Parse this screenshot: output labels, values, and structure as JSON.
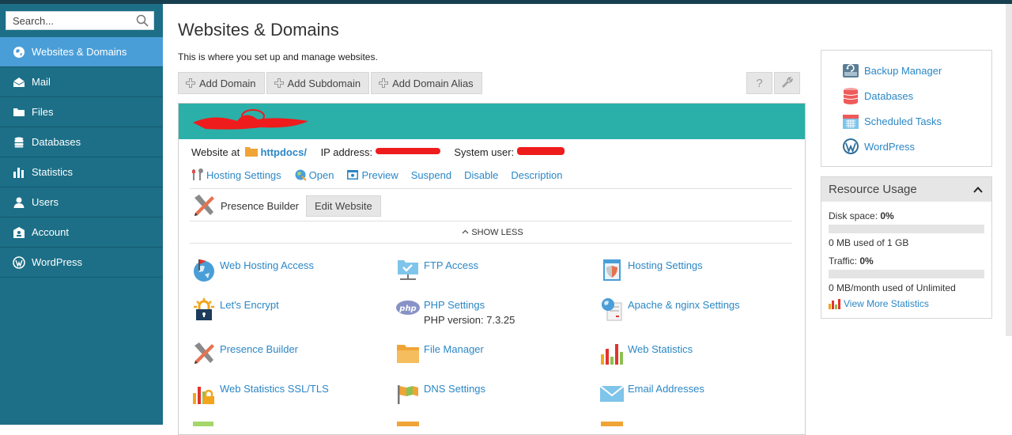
{
  "search": {
    "placeholder": "Search..."
  },
  "sidebar": {
    "items": [
      {
        "label": "Websites & Domains",
        "icon": "globe-icon",
        "active": true
      },
      {
        "label": "Mail",
        "icon": "envelope-icon"
      },
      {
        "label": "Files",
        "icon": "folder-icon"
      },
      {
        "label": "Databases",
        "icon": "database-icon"
      },
      {
        "label": "Statistics",
        "icon": "bar-chart-icon"
      },
      {
        "label": "Users",
        "icon": "user-icon"
      },
      {
        "label": "Account",
        "icon": "account-icon"
      },
      {
        "label": "WordPress",
        "icon": "wordpress-icon"
      }
    ]
  },
  "main": {
    "title": "Websites & Domains",
    "description": "This is where you set up and manage websites.",
    "toolbar": {
      "add_domain": "Add Domain",
      "add_subdomain": "Add Subdomain",
      "add_domain_alias": "Add Domain Alias",
      "help_icon": "?",
      "settings_icon": "wrench-icon"
    }
  },
  "domain": {
    "website_at_label": "Website at",
    "docroot": "httpdocs/",
    "ip_label": "IP address:",
    "system_user_label": "System user:",
    "actions": [
      {
        "label": "Hosting Settings",
        "icon": "hosting-settings-icon"
      },
      {
        "label": "Open",
        "icon": "open-globe-icon"
      },
      {
        "label": "Preview",
        "icon": "preview-icon"
      },
      {
        "label": "Suspend"
      },
      {
        "label": "Disable"
      },
      {
        "label": "Description"
      }
    ],
    "presence_builder_label": "Presence Builder",
    "edit_website": "Edit Website",
    "show_less": "SHOW LESS",
    "tools": [
      {
        "label": "Web Hosting Access",
        "icon": "web-hosting-access-icon"
      },
      {
        "label": "FTP Access",
        "icon": "ftp-access-icon"
      },
      {
        "label": "Hosting Settings",
        "icon": "hosting-settings-shield-icon"
      },
      {
        "label": "Let's Encrypt",
        "icon": "lets-encrypt-icon"
      },
      {
        "label": "PHP Settings",
        "icon": "php-icon",
        "sub": "PHP version: 7.3.25"
      },
      {
        "label": "Apache & nginx Settings",
        "icon": "apache-nginx-icon"
      },
      {
        "label": "Presence Builder",
        "icon": "presence-builder-icon"
      },
      {
        "label": "File Manager",
        "icon": "file-manager-icon"
      },
      {
        "label": "Web Statistics",
        "icon": "web-statistics-icon"
      },
      {
        "label": "Web Statistics SSL/TLS",
        "icon": "web-statistics-ssl-icon"
      },
      {
        "label": "DNS Settings",
        "icon": "dns-settings-icon"
      },
      {
        "label": "Email Addresses",
        "icon": "email-addresses-icon"
      }
    ]
  },
  "quick_links": [
    {
      "label": "Backup Manager",
      "icon": "backup-manager-icon"
    },
    {
      "label": "Databases",
      "icon": "databases-icon"
    },
    {
      "label": "Scheduled Tasks",
      "icon": "scheduled-tasks-icon"
    },
    {
      "label": "WordPress",
      "icon": "wordpress-icon"
    }
  ],
  "resource_usage": {
    "title": "Resource Usage",
    "disk_label": "Disk space:",
    "disk_value": "0%",
    "disk_fill": 0,
    "disk_detail": "0 MB used of 1 GB",
    "traffic_label": "Traffic:",
    "traffic_value": "0%",
    "traffic_fill": 0,
    "traffic_detail": "0 MB/month used of Unlimited",
    "view_more": "View More Statistics"
  },
  "colors": {
    "sidebar_bg": "#1c6f87",
    "sidebar_active": "#4a9ed8",
    "card_header": "#2ab0a8",
    "link": "#2b87c6",
    "redaction": "#ee1c1c"
  }
}
